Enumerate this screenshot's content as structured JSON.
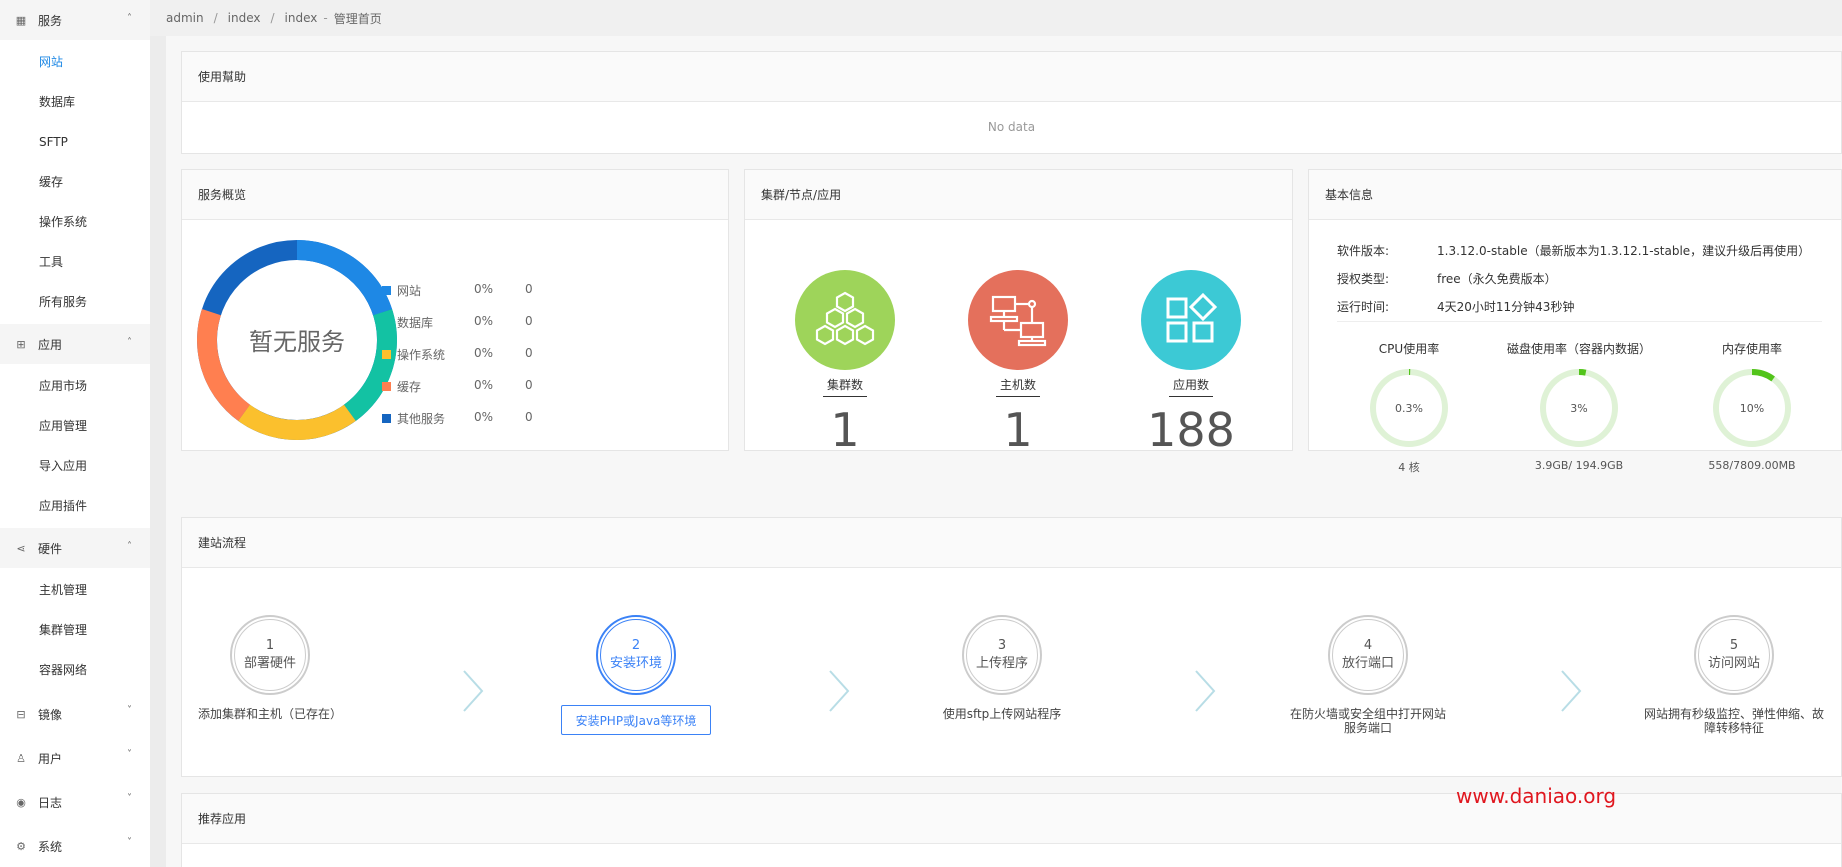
{
  "sidebar": {
    "groups": [
      {
        "label": "服务",
        "icon": "grid-icon",
        "chevron": "˄",
        "items": [
          "网站",
          "数据库",
          "SFTP",
          "缓存",
          "操作系统",
          "工具",
          "所有服务"
        ]
      },
      {
        "label": "应用",
        "icon": "apps-icon",
        "chevron": "˄",
        "items": [
          "应用市场",
          "应用管理",
          "导入应用",
          "应用插件"
        ]
      },
      {
        "label": "硬件",
        "icon": "share-icon",
        "chevron": "˄",
        "items": [
          "主机管理",
          "集群管理",
          "容器网络"
        ]
      },
      {
        "label": "镜像",
        "icon": "disk-icon",
        "chevron": "˅"
      },
      {
        "label": "用户",
        "icon": "user-icon",
        "chevron": "˅"
      },
      {
        "label": "日志",
        "icon": "eye-icon",
        "chevron": "˅"
      },
      {
        "label": "系统",
        "icon": "gear-icon",
        "chevron": "˅"
      }
    ],
    "active_item": "网站"
  },
  "breadcrumb": {
    "items": [
      "admin",
      "index",
      "index"
    ],
    "current": "管理首页",
    "dash": "-",
    "slash": "/"
  },
  "help_panel": {
    "title": "使用幫助",
    "empty_text": "No data"
  },
  "overview_panel": {
    "title": "服务概览",
    "center_text": "暂无服务",
    "legend": [
      {
        "name": "网站",
        "pct": "0%",
        "count": "0",
        "color": "#1e88e5"
      },
      {
        "name": "数据库",
        "pct": "0%",
        "count": "0",
        "color": "#13c2a3"
      },
      {
        "name": "操作系统",
        "pct": "0%",
        "count": "0",
        "color": "#fbc02d"
      },
      {
        "name": "缓存",
        "pct": "0%",
        "count": "0",
        "color": "#ff7f50"
      },
      {
        "name": "其他服务",
        "pct": "0%",
        "count": "0",
        "color": "#1565c0"
      }
    ]
  },
  "cluster_panel": {
    "title": "集群/节点/应用",
    "stats": [
      {
        "label": "集群数",
        "value": "1",
        "color": "#9ed45a",
        "icon": "hexagon-cluster-icon"
      },
      {
        "label": "主机数",
        "value": "1",
        "color": "#e4705c",
        "icon": "network-hosts-icon"
      },
      {
        "label": "应用数",
        "value": "188",
        "color": "#3cc9d5",
        "icon": "apps-grid-icon"
      }
    ]
  },
  "info_panel": {
    "title": "基本信息",
    "rows": [
      {
        "key": "软件版本:",
        "value": "1.3.12.0-stable（最新版本为1.3.12.1-stable，建议升级后再使用）"
      },
      {
        "key": "授权类型:",
        "value": "free（永久免费版本）"
      },
      {
        "key": "运行时间:",
        "value": "4天20小时11分钟43秒钟"
      }
    ],
    "gauges": [
      {
        "title": "CPU使用率",
        "value_text": "0.3%",
        "fraction": 0.003,
        "footer": "4 核"
      },
      {
        "title": "磁盘使用率（容器内数据）",
        "value_text": "3%",
        "fraction": 0.03,
        "footer": "3.9GB/ 194.9GB"
      },
      {
        "title": "内存使用率",
        "value_text": "10%",
        "fraction": 0.1,
        "footer": "558/7809.00MB"
      }
    ]
  },
  "flow_panel": {
    "title": "建站流程",
    "steps": [
      {
        "num": "1",
        "name": "部署硬件",
        "desc": "添加集群和主机（已存在）",
        "active": false
      },
      {
        "num": "2",
        "name": "安装环境",
        "button": "安装PHP或Java等环境",
        "active": true
      },
      {
        "num": "3",
        "name": "上传程序",
        "desc": "使用sftp上传网站程序",
        "active": false
      },
      {
        "num": "4",
        "name": "放行端口",
        "desc": "在防火墙或安全组中打开网站服务端口",
        "active": false
      },
      {
        "num": "5",
        "name": "访问网站",
        "desc": "网站拥有秒级监控、弹性伸缩、故障转移特征",
        "active": false
      }
    ]
  },
  "recommend_panel": {
    "title": "推荐应用"
  },
  "watermark": "www.daniao.org"
}
